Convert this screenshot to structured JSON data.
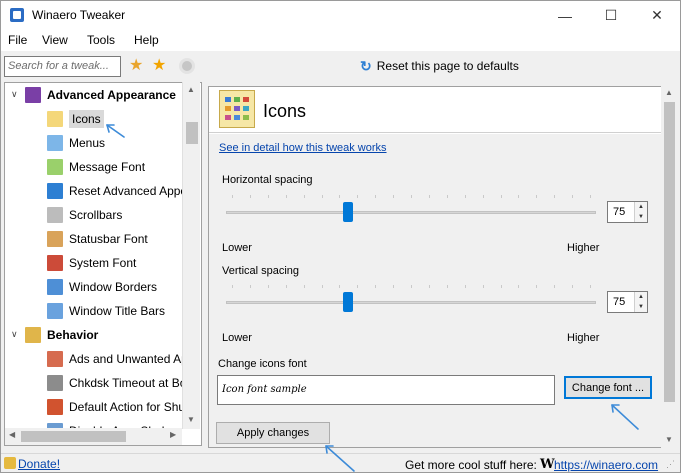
{
  "window": {
    "title": "Winaero Tweaker"
  },
  "window_controls": {
    "minimize": "—",
    "maximize": "☐",
    "close": "✕"
  },
  "menu": [
    "File",
    "View",
    "Tools",
    "Help"
  ],
  "toolbar": {
    "search_placeholder": "Search for a tweak...",
    "reset_label": "Reset this page to defaults"
  },
  "tree": {
    "items": [
      {
        "label": "Advanced Appearance",
        "icon": "palette-icon",
        "color": "#7a3fa6"
      },
      {
        "label": "Icons",
        "icon": "icons-folder-icon",
        "color": "#f4d77a"
      },
      {
        "label": "Menus",
        "icon": "menu-icon",
        "color": "#7db6e8"
      },
      {
        "label": "Message Font",
        "icon": "message-font-icon",
        "color": "#9ad06b"
      },
      {
        "label": "Reset Advanced Appea",
        "icon": "reset-icon",
        "color": "#2d7fd3"
      },
      {
        "label": "Scrollbars",
        "icon": "scrollbars-icon",
        "color": "#bcbcbc"
      },
      {
        "label": "Statusbar Font",
        "icon": "statusbar-font-icon",
        "color": "#d9a35a"
      },
      {
        "label": "System Font",
        "icon": "system-font-icon",
        "color": "#cc4b39"
      },
      {
        "label": "Window Borders",
        "icon": "window-borders-icon",
        "color": "#4e8fd6"
      },
      {
        "label": "Window Title Bars",
        "icon": "window-title-bars-icon",
        "color": "#6aa2de"
      },
      {
        "label": "Behavior",
        "icon": "behavior-icon",
        "color": "#e0b54a"
      },
      {
        "label": "Ads and Unwanted Appl",
        "icon": "ads-icon",
        "color": "#d66b4f"
      },
      {
        "label": "Chkdsk Timeout at Boot",
        "icon": "disk-icon",
        "color": "#8c8c8c"
      },
      {
        "label": "Default Action for Shutd",
        "icon": "shutdown-icon",
        "color": "#d1532f"
      },
      {
        "label": "Disable Aero Shake",
        "icon": "aero-shake-icon",
        "color": "#6a9bd1"
      }
    ]
  },
  "content": {
    "title": "Icons",
    "detail_link": "See in detail how this tweak works",
    "horizontal": {
      "label": "Horizontal spacing",
      "value": "75",
      "low": "Lower",
      "high": "Higher",
      "level": 0.33
    },
    "vertical": {
      "label": "Vertical spacing",
      "value": "75",
      "low": "Lower",
      "high": "Higher",
      "level": 0.33
    },
    "font_label": "Change icons font",
    "font_sample": "Icon font sample",
    "change_font_button": "Change font ...",
    "apply_button": "Apply changes"
  },
  "status": {
    "donate": "Donate!",
    "more": "Get more cool stuff here:",
    "logo": "W",
    "site": "https://winaero.com"
  },
  "colors": {
    "accent": "#0078d7",
    "link": "#0645ad",
    "annotation": "#3d8bd8"
  }
}
